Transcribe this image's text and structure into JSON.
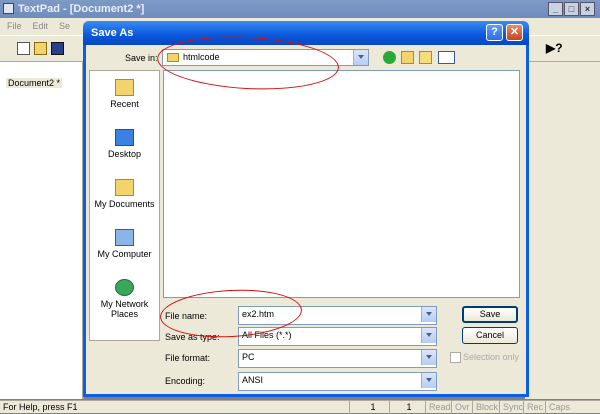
{
  "app": {
    "title": "TextPad - [Document2 *]",
    "menu": [
      "File",
      "Edit",
      "Se"
    ],
    "document_tab": "Document2 *",
    "status": {
      "help": "For Help, press F1",
      "line": "1",
      "col": "1",
      "indicators": [
        "Read",
        "Ovr",
        "Block",
        "Sync",
        "Rec",
        "Caps"
      ]
    }
  },
  "dialog": {
    "title": "Save As",
    "help_label": "?",
    "close_label": "✕",
    "save_in_label": "Save in:",
    "save_in_value": "htmlcode",
    "places": [
      {
        "label": "Recent",
        "icon": "recent-folder-icon"
      },
      {
        "label": "Desktop",
        "icon": "desktop-icon"
      },
      {
        "label": "My Documents",
        "icon": "my-documents-icon"
      },
      {
        "label": "My Computer",
        "icon": "my-computer-icon"
      },
      {
        "label": "My Network Places",
        "icon": "network-places-icon"
      }
    ],
    "file_name_label": "File name:",
    "file_name_value": "ex2.htm",
    "save_as_type_label": "Save as type:",
    "save_as_type_value": "All Files (*.*)",
    "file_format_label": "File format:",
    "file_format_value": "PC",
    "encoding_label": "Encoding:",
    "encoding_value": "ANSI",
    "save_button": "Save",
    "cancel_button": "Cancel",
    "selection_only_label": "Selection only"
  },
  "colors": {
    "xp_blue": "#0a5fe6",
    "dialog_face": "#ece9d8",
    "annotation_red": "#d41010"
  }
}
